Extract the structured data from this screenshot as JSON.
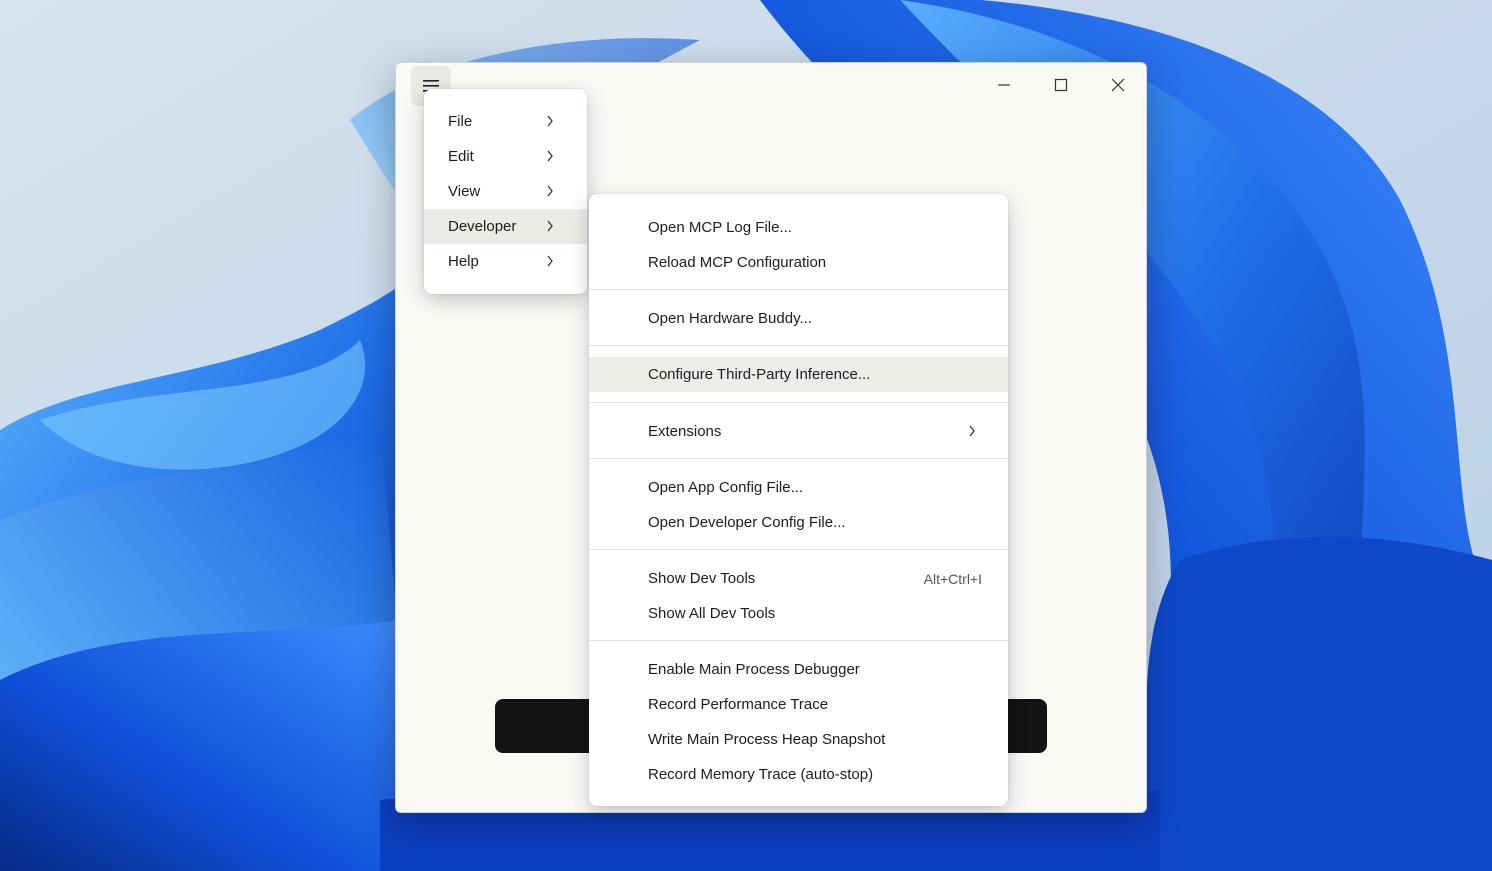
{
  "colors": {
    "window_bg": "#faf9f6",
    "menu_bg": "#ffffff",
    "hover_bg": "#ededea",
    "primary_button_bg": "#131313",
    "wallpaper_blue": "#1f6fe8"
  },
  "titlebar": {
    "menu_icon": "hamburger-icon",
    "controls": [
      "minimize-icon",
      "maximize-icon",
      "close-icon"
    ]
  },
  "main_menu": {
    "items": [
      {
        "label": "File",
        "submenu": true
      },
      {
        "label": "Edit",
        "submenu": true
      },
      {
        "label": "View",
        "submenu": true
      },
      {
        "label": "Developer",
        "submenu": true,
        "active": true
      },
      {
        "label": "Help",
        "submenu": true
      }
    ]
  },
  "developer_menu": {
    "groups": [
      [
        {
          "label": "Open MCP Log File..."
        },
        {
          "label": "Reload MCP Configuration"
        }
      ],
      [
        {
          "label": "Open Hardware Buddy..."
        }
      ],
      [
        {
          "label": "Configure Third-Party Inference...",
          "highlighted": true
        }
      ],
      [
        {
          "label": "Extensions",
          "submenu": true
        }
      ],
      [
        {
          "label": "Open App Config File..."
        },
        {
          "label": "Open Developer Config File..."
        }
      ],
      [
        {
          "label": "Show Dev Tools",
          "shortcut": "Alt+Ctrl+I"
        },
        {
          "label": "Show All Dev Tools"
        }
      ],
      [
        {
          "label": "Enable Main Process Debugger"
        },
        {
          "label": "Record Performance Trace"
        },
        {
          "label": "Write Main Process Heap Snapshot"
        },
        {
          "label": "Record Memory Trace (auto-stop)"
        }
      ]
    ]
  }
}
